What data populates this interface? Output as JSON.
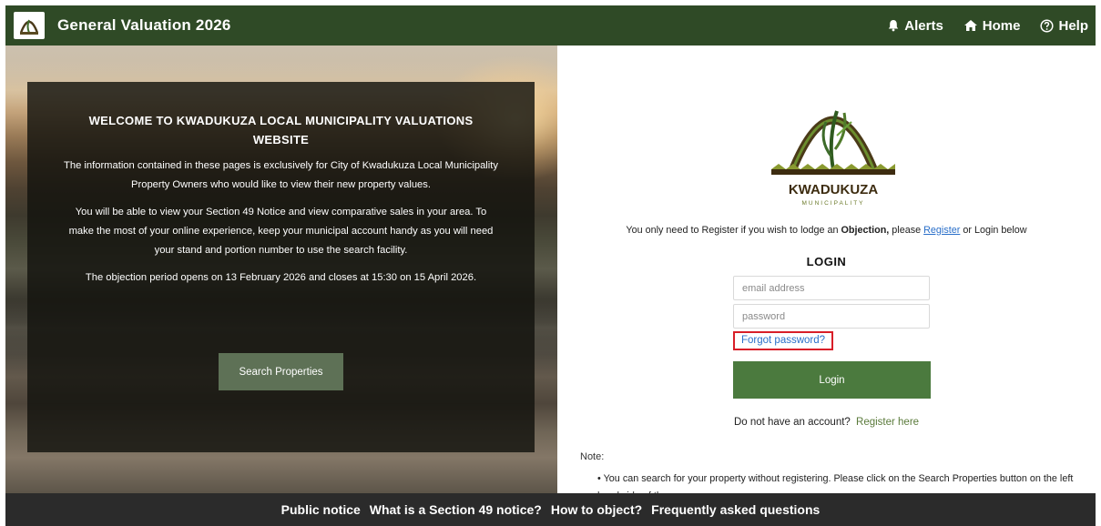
{
  "header": {
    "title": "General Valuation 2026",
    "logo_icon": "municipality-logo-icon",
    "nav": [
      {
        "label": "Alerts",
        "icon": "bell-icon"
      },
      {
        "label": "Home",
        "icon": "home-icon"
      },
      {
        "label": "Help",
        "icon": "help-circle-icon"
      }
    ]
  },
  "welcome": {
    "title": "WELCOME TO KWADUKUZA LOCAL MUNICIPALITY VALUATIONS WEBSITE",
    "p1": "The information contained in these pages is exclusively for City of Kwadukuza Local Municipality Property Owners who would like to view their new property values.",
    "p2": "You will be able to view your Section 49 Notice and view comparative sales in your area. To make the most of your online experience, keep your municipal account handy as you will need your stand and portion number to use the search facility.",
    "p3": "The objection period opens on 13 February 2026 and closes at 15:30 on 15 April 2026.",
    "search_button": "Search Properties"
  },
  "login": {
    "register_note_before": "You only need to Register if you wish to lodge an ",
    "register_note_bold": "Objection,",
    "register_note_mid": " please ",
    "register_link": "Register",
    "register_note_after": " or Login below",
    "title": "LOGIN",
    "email_placeholder": "email address",
    "password_placeholder": "password",
    "forgot": "Forgot password?",
    "button": "Login",
    "no_account": "Do not have an account?",
    "register_here": "Register here",
    "note_label": "Note:",
    "note_item": "You can search for your property without registering. Please click on the Search Properties button on the left hand side of the screen"
  },
  "logo": {
    "text_main": "KWADUKUZA",
    "text_sub": "MUNICIPALITY"
  },
  "footer": {
    "links": [
      "Public notice",
      "What is a Section 49 notice?",
      "How to object?",
      "Frequently asked questions"
    ]
  },
  "colors": {
    "header_bg": "#2f4a26",
    "login_button": "#4b7a3e",
    "search_button": "#5e7156",
    "highlight_border": "#d81e28",
    "link": "#2a6fc9",
    "footer_bg": "#2b2b2b"
  }
}
